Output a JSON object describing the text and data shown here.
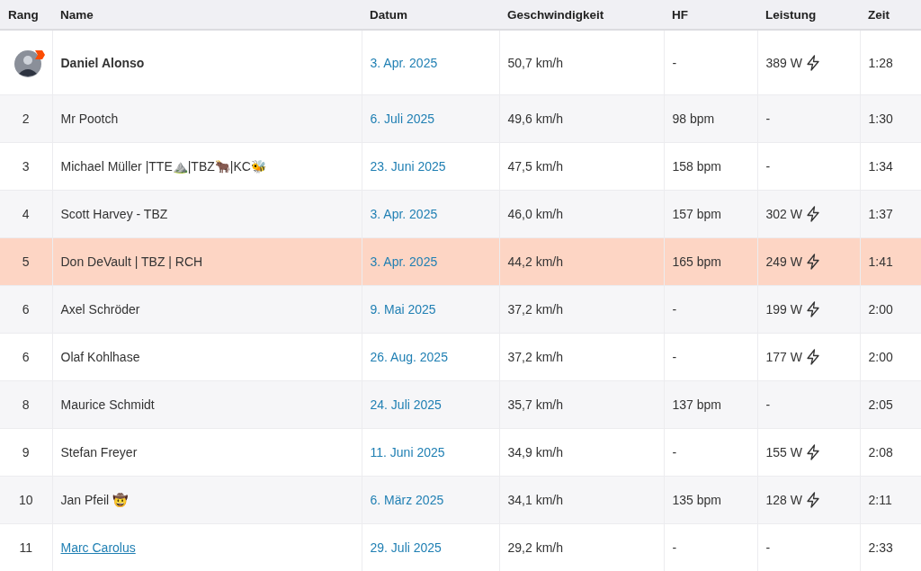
{
  "columns": [
    "Rang",
    "Name",
    "Datum",
    "Geschwindigkeit",
    "HF",
    "Leistung",
    "Zeit"
  ],
  "rows": [
    {
      "kind": "own",
      "name": "Daniel Alonso",
      "highlighted": false,
      "date": "3. Apr. 2025",
      "speed": "50,7 km/h",
      "hr": "-",
      "power": "389 W",
      "power_icon": true,
      "time": "1:28"
    },
    {
      "kind": "athlete",
      "rank": "2",
      "name": "Mr Pootch",
      "highlighted": false,
      "date": "6. Juli 2025",
      "speed": "49,6 km/h",
      "hr": "98 bpm",
      "power": "-",
      "power_icon": false,
      "time": "1:30"
    },
    {
      "kind": "athlete",
      "rank": "3",
      "name": "Michael Müller |TTE⛰️|TBZ🐂|KC🐝",
      "highlighted": false,
      "date": "23. Juni 2025",
      "speed": "47,5 km/h",
      "hr": "158 bpm",
      "power": "-",
      "power_icon": false,
      "time": "1:34"
    },
    {
      "kind": "athlete",
      "rank": "4",
      "name": "Scott Harvey - TBZ",
      "highlighted": false,
      "date": "3. Apr. 2025",
      "speed": "46,0 km/h",
      "hr": "157 bpm",
      "power": "302 W",
      "power_icon": true,
      "time": "1:37"
    },
    {
      "kind": "athlete",
      "rank": "5",
      "name": "Don DeVault | TBZ | RCH",
      "highlighted": true,
      "date": "3. Apr. 2025",
      "speed": "44,2 km/h",
      "hr": "165 bpm",
      "power": "249 W",
      "power_icon": true,
      "time": "1:41"
    },
    {
      "kind": "athlete",
      "rank": "6",
      "name": "Axel Schröder",
      "highlighted": false,
      "date": "9. Mai 2025",
      "speed": "37,2 km/h",
      "hr": "-",
      "power": "199 W",
      "power_icon": true,
      "time": "2:00"
    },
    {
      "kind": "athlete",
      "rank": "6",
      "name": "Olaf Kohlhase",
      "highlighted": false,
      "date": "26. Aug. 2025",
      "speed": "37,2 km/h",
      "hr": "-",
      "power": "177 W",
      "power_icon": true,
      "time": "2:00"
    },
    {
      "kind": "athlete",
      "rank": "8",
      "name": "Maurice Schmidt",
      "highlighted": false,
      "date": "24. Juli 2025",
      "speed": "35,7 km/h",
      "hr": "137 bpm",
      "power": "-",
      "power_icon": false,
      "time": "2:05"
    },
    {
      "kind": "athlete",
      "rank": "9",
      "name": "Stefan Freyer",
      "highlighted": false,
      "date": "11. Juni 2025",
      "speed": "34,9 km/h",
      "hr": "-",
      "power": "155 W",
      "power_icon": true,
      "time": "2:08"
    },
    {
      "kind": "athlete",
      "rank": "10",
      "name": "Jan Pfeil 🤠",
      "highlighted": false,
      "date": "6. März 2025",
      "speed": "34,1 km/h",
      "hr": "135 bpm",
      "power": "128 W",
      "power_icon": true,
      "time": "2:11"
    },
    {
      "kind": "link",
      "rank": "11",
      "name": "Marc Carolus",
      "highlighted": false,
      "date": "29. Juli 2025",
      "speed": "29,2 km/h",
      "hr": "-",
      "power": "-",
      "power_icon": false,
      "time": "2:33"
    }
  ]
}
